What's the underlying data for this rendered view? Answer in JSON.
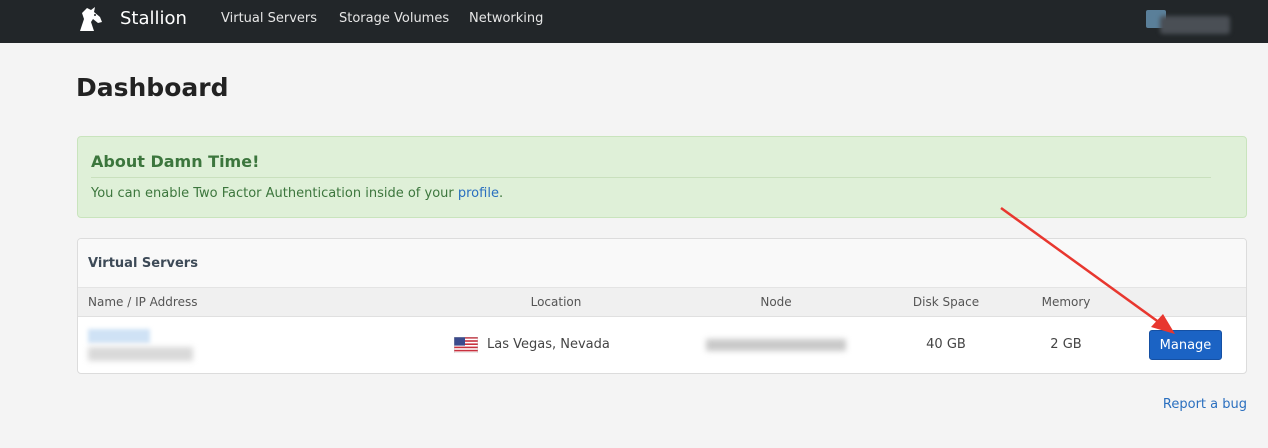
{
  "navbar": {
    "brand": "Stallion",
    "links": [
      "Virtual Servers",
      "Storage Volumes",
      "Networking"
    ]
  },
  "page": {
    "title": "Dashboard"
  },
  "alert": {
    "title": "About Damn Time!",
    "text_before_link": "You can enable Two Factor Authentication inside of your ",
    "link": "profile",
    "text_after_link": "."
  },
  "servers_panel": {
    "title": "Virtual Servers",
    "columns": [
      "Name / IP Address",
      "Location",
      "Node",
      "Disk Space",
      "Memory"
    ],
    "rows": [
      {
        "location": "Las Vegas, Nevada",
        "flag_icon": "us-flag-icon",
        "disk": "40 GB",
        "memory": "2 GB",
        "action": "Manage"
      }
    ]
  },
  "footer": {
    "report_link": "Report a bug"
  },
  "colors": {
    "navbar_bg": "#222629",
    "alert_bg": "#dff0d8",
    "alert_text": "#3c763d",
    "primary_button": "#1b63c4",
    "link": "#2a6fbf",
    "annotation_arrow": "#e8372f"
  }
}
